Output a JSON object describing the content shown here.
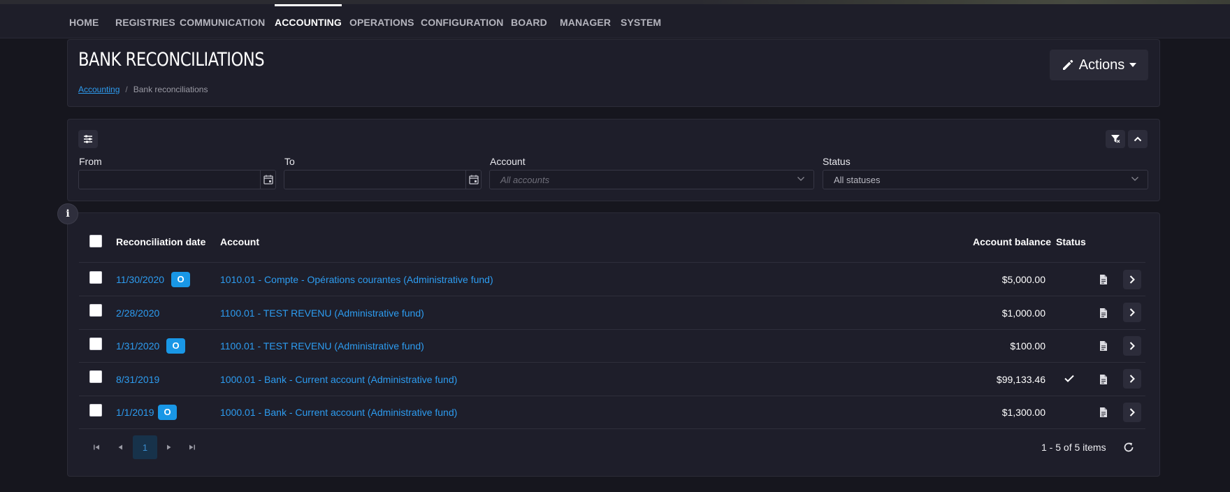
{
  "nav": {
    "items": [
      {
        "label": "HOME"
      },
      {
        "label": "REGISTRIES"
      },
      {
        "label": "COMMUNICATION"
      },
      {
        "label": "ACCOUNTING",
        "active": true
      },
      {
        "label": "OPERATIONS"
      },
      {
        "label": "CONFIGURATION"
      },
      {
        "label": "BOARD"
      },
      {
        "label": "MANAGER"
      },
      {
        "label": "SYSTEM"
      }
    ]
  },
  "header": {
    "title": "BANK RECONCILIATIONS",
    "breadcrumb": {
      "parent": "Accounting",
      "current": "Bank reconciliations"
    },
    "actions_label": "Actions",
    "actions_icon": "pencil-icon"
  },
  "filters": {
    "from_label": "From",
    "from_value": "",
    "to_label": "To",
    "to_value": "",
    "account_label": "Account",
    "account_placeholder": "All accounts",
    "status_label": "Status",
    "status_value": "All statuses"
  },
  "table": {
    "headers": {
      "date": "Reconciliation date",
      "account": "Account",
      "balance": "Account balance",
      "status": "Status"
    },
    "badge_label": "O",
    "rows": [
      {
        "date": "11/30/2020",
        "badge": true,
        "account": "1010.01 - Compte - Opérations courantes (Administrative fund)",
        "balance": "$5,000.00",
        "reconciled": false
      },
      {
        "date": "2/28/2020",
        "badge": false,
        "account": "1100.01 - TEST REVENU (Administrative fund)",
        "balance": "$1,000.00",
        "reconciled": false
      },
      {
        "date": "1/31/2020",
        "badge": true,
        "account": "1100.01 - TEST REVENU (Administrative fund)",
        "balance": "$100.00",
        "reconciled": false
      },
      {
        "date": "8/31/2019",
        "badge": false,
        "account": "1000.01 - Bank - Current account (Administrative fund)",
        "balance": "$99,133.46",
        "reconciled": true
      },
      {
        "date": "1/1/2019",
        "badge": true,
        "account": "1000.01 - Bank - Current account (Administrative fund)",
        "balance": "$1,300.00",
        "reconciled": false
      }
    ]
  },
  "pager": {
    "current_page": "1",
    "items_info": "1 - 5 of 5 items"
  },
  "colors": {
    "accent": "#2d9cf0",
    "badge": "#1997e6",
    "background": "#16161e",
    "card": "#1e1e2a"
  }
}
